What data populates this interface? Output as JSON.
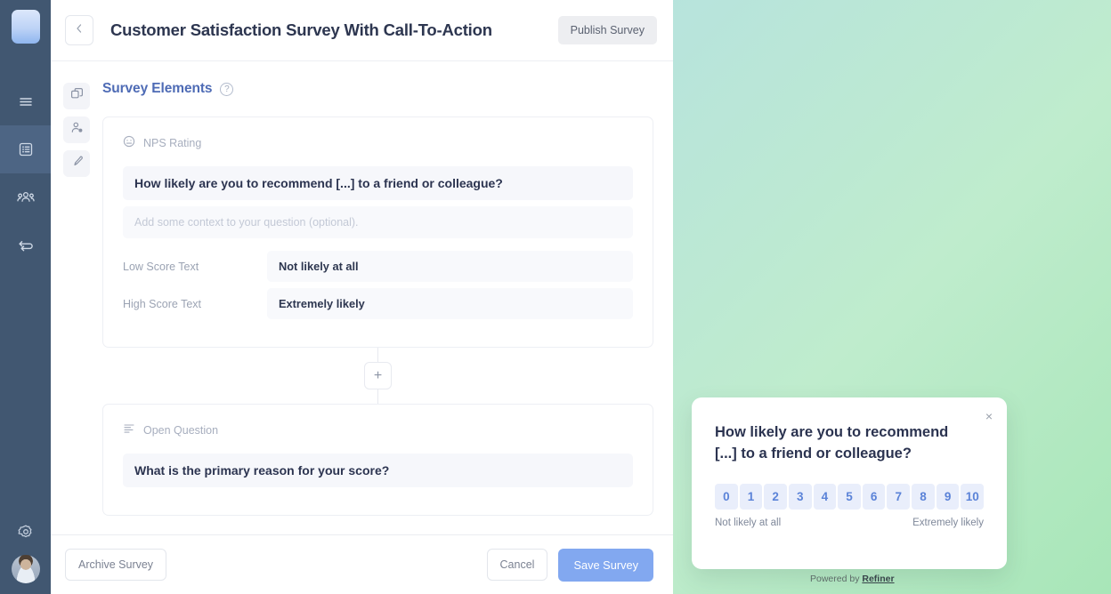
{
  "app": {
    "brand_logo_name": "refiner-logo",
    "sidebar": {
      "items": [
        {
          "name": "sidebar-item-menu",
          "icon": "hamburger-menu-icon",
          "active": false
        },
        {
          "name": "sidebar-item-surveys",
          "icon": "survey-list-icon",
          "active": true
        },
        {
          "name": "sidebar-item-contacts",
          "icon": "people-group-icon",
          "active": false
        },
        {
          "name": "sidebar-item-sync",
          "icon": "sync-arrows-icon",
          "active": false
        }
      ],
      "settings_icon": "gear-icon",
      "avatar_name": "user-avatar"
    }
  },
  "header": {
    "back_label": "‹",
    "title": "Customer Satisfaction Survey With Call-To-Action",
    "publish_label": "Publish Survey"
  },
  "tool_rail": {
    "items": [
      {
        "name": "tool-elements",
        "icon": "layers-copy-icon"
      },
      {
        "name": "tool-targeting",
        "icon": "person-settings-icon"
      },
      {
        "name": "tool-styling",
        "icon": "paintbrush-icon"
      }
    ]
  },
  "editor": {
    "section_title": "Survey Elements",
    "help_glyph": "?",
    "elements": [
      {
        "type_label": "NPS Rating",
        "type_icon": "smiley-face-icon",
        "question": "How likely are you to recommend [...] to a friend or colleague?",
        "context_placeholder": "Add some context to your question (optional).",
        "fields": [
          {
            "label": "Low Score Text",
            "value": "Not likely at all"
          },
          {
            "label": "High Score Text",
            "value": "Extremely likely"
          }
        ]
      },
      {
        "type_label": "Open Question",
        "type_icon": "align-left-list-icon",
        "question": "What is the primary reason for your score?"
      }
    ],
    "add_element_glyph": "+"
  },
  "actionbar": {
    "archive_label": "Archive Survey",
    "cancel_label": "Cancel",
    "save_label": "Save Survey"
  },
  "preview": {
    "close_glyph": "×",
    "question": "How likely are you to recommend [...] to a friend or colleague?",
    "scale": [
      "0",
      "1",
      "2",
      "3",
      "4",
      "5",
      "6",
      "7",
      "8",
      "9",
      "10"
    ],
    "low_label": "Not likely at all",
    "high_label": "Extremely likely",
    "powered_prefix": "Powered by ",
    "powered_brand": "Refiner"
  },
  "colors": {
    "sidebar_bg": "#415771",
    "sidebar_active": "#4d6584",
    "accent_blue": "#4e6bb5",
    "primary_button": "#82a8f0",
    "scale_button_bg": "#e9eefb",
    "scale_button_text": "#5b83d8",
    "gradient_start": "#a8dbe8",
    "gradient_end": "#a8e6b8"
  }
}
